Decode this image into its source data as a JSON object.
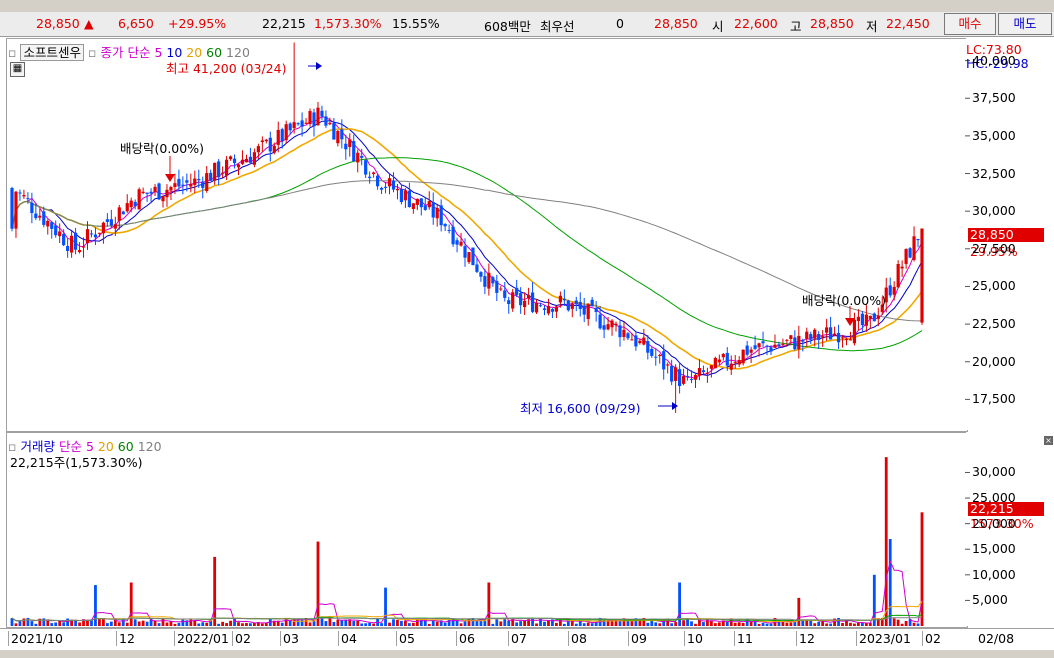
{
  "quote": {
    "price": "28,850",
    "change": "6,650",
    "change_pct": "+29.95%",
    "volume": "22,215",
    "vol_ratio": "1,573.30%",
    "turnover": "15.55%",
    "amount": "608백만",
    "best_label": "최우선",
    "best_value": "0",
    "ask": "28,850",
    "open_label": "시",
    "open": "22,600",
    "high_label": "고",
    "high": "28,850",
    "low_label": "저",
    "low": "22,450",
    "buy_label": "매수",
    "sell_label": "매도"
  },
  "price_panel": {
    "name": "소프트센우",
    "legend_title": "종가",
    "legend_type": "단순",
    "ma": [
      "5",
      "10",
      "20",
      "60",
      "120"
    ],
    "lc": "LC:73.80",
    "hc": "HC:-29.98",
    "high_ann": "최고 41,200 (03/24)",
    "low_ann": "최저 16,600 (09/29)",
    "div1": "배당락(0.00%)",
    "div2": "배당락(0.00%)",
    "last_badge": "28,850",
    "last_pct": "29.95%",
    "ticks": [
      "40,000",
      "37,500",
      "35,000",
      "32,500",
      "30,000",
      "27,500",
      "25,000",
      "22,500",
      "20,000",
      "17,500"
    ]
  },
  "volume_panel": {
    "title": "거래량",
    "legend_type": "단순",
    "ma": [
      "5",
      "20",
      "60",
      "120"
    ],
    "summary": "22,215주(1,573.30%)",
    "last_badge": "22,215",
    "last_pct": "1573.30%",
    "ticks": [
      "30,000",
      "25,000",
      "20,000",
      "15,000",
      "10,000",
      "5,000"
    ]
  },
  "xaxis": [
    "2021/10",
    "12",
    "2022/01",
    "02",
    "03",
    "04",
    "05",
    "06",
    "07",
    "08",
    "09",
    "10",
    "11",
    "12",
    "2023/01",
    "02",
    "02/08"
  ],
  "chart_data": {
    "type": "candlestick",
    "x": [
      "2021/10",
      "12",
      "2022/01",
      "02",
      "03",
      "04",
      "05",
      "06",
      "07",
      "08",
      "09",
      "10",
      "11",
      "12",
      "2023/01",
      "02"
    ],
    "close": [
      31500,
      27500,
      31000,
      32000,
      34000,
      36500,
      32000,
      29500,
      24000,
      23900,
      22000,
      18500,
      20800,
      21500,
      22500,
      28850
    ],
    "ylim": [
      15600,
      41500
    ],
    "volume": [
      1200,
      1500,
      1500,
      1500,
      1200,
      6000,
      1000,
      1000,
      800,
      600,
      700,
      3000,
      800,
      900,
      14000,
      22215
    ],
    "vol_ylim": [
      0,
      34000
    ]
  },
  "colors": {
    "up": "#e00000",
    "down": "#0050ff",
    "ma5": "#d000d0",
    "ma10": "#0000cc",
    "ma20": "#f0a800",
    "ma60": "#00a000",
    "ma120": "#808080"
  }
}
